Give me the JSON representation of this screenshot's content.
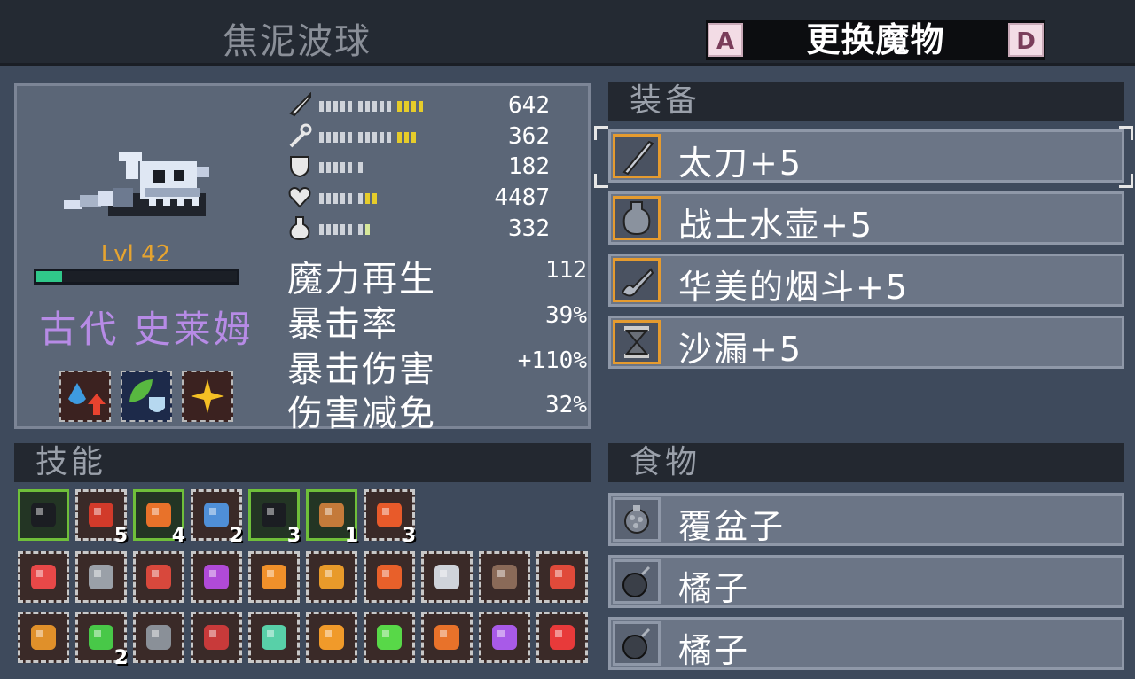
{
  "header": {
    "monster_name": "焦泥波球",
    "switch_label": "更换魔物",
    "key_left": "A",
    "key_right": "D"
  },
  "monster": {
    "level": "Lvl 42",
    "species": "古代 史莱姆",
    "hp_fill": 0.13,
    "colors": {
      "level": "#e6a430",
      "species": "#b78be6",
      "hp": "#30c88a"
    }
  },
  "stats": [
    {
      "icon": "sword-icon",
      "value": "642"
    },
    {
      "icon": "staff-icon",
      "value": "362"
    },
    {
      "icon": "shield-icon",
      "value": "182"
    },
    {
      "icon": "heart-icon",
      "value": "4487"
    },
    {
      "icon": "mana-flask-icon",
      "value": "332"
    }
  ],
  "big_stats": [
    {
      "label": "魔力再生",
      "value": "112"
    },
    {
      "label": "暴击率",
      "value": "39%"
    },
    {
      "label": "暴击伤害",
      "value": "+110%"
    },
    {
      "label": "伤害减免",
      "value": "32%"
    }
  ],
  "equipment": {
    "title": "装备",
    "items": [
      {
        "label": "太刀+5",
        "icon": "katana-icon"
      },
      {
        "label": "战士水壶+5",
        "icon": "flask-icon"
      },
      {
        "label": "华美的烟斗+5",
        "icon": "pipe-icon"
      },
      {
        "label": "沙漏+5",
        "icon": "hourglass-icon"
      }
    ]
  },
  "food": {
    "title": "食物",
    "items": [
      {
        "label": "覆盆子",
        "icon": "raspberry-icon"
      },
      {
        "label": "橘子",
        "icon": "bomb-icon"
      },
      {
        "label": "橘子",
        "icon": "bomb-icon"
      }
    ]
  },
  "skills": {
    "title": "技能",
    "row1": [
      {
        "icon": "coal-icon",
        "count": ""
      },
      {
        "icon": "claw-slash-icon",
        "count": "5"
      },
      {
        "icon": "fire-rock-icon",
        "count": "4"
      },
      {
        "icon": "blue-orb-icon",
        "count": "2"
      },
      {
        "icon": "coal-icon",
        "count": "3"
      },
      {
        "icon": "drumstick-icon",
        "count": "1"
      },
      {
        "icon": "flame-claw-icon",
        "count": "3"
      }
    ],
    "row2": [
      "heart-shield-icon",
      "stone-ring-icon",
      "red-hair-icon",
      "purple-heart-icon",
      "orange-rune-icon",
      "target-potion-icon",
      "fire-card-icon",
      "bat-icon",
      "skeleton-icon",
      "red-fist-icon"
    ],
    "row3_counts": [
      "",
      "2",
      "",
      "",
      "",
      "",
      "",
      "",
      "",
      ""
    ],
    "row3": [
      "gear-sword-icon",
      "green-heart-icon",
      "rune-stone-icon",
      "red-tile-icon",
      "stars-icon",
      "orange-hourglass-icon",
      "green-hourglass-icon",
      "fire-lance-icon",
      "purple-flame-icon",
      "red-orbs-icon"
    ]
  }
}
